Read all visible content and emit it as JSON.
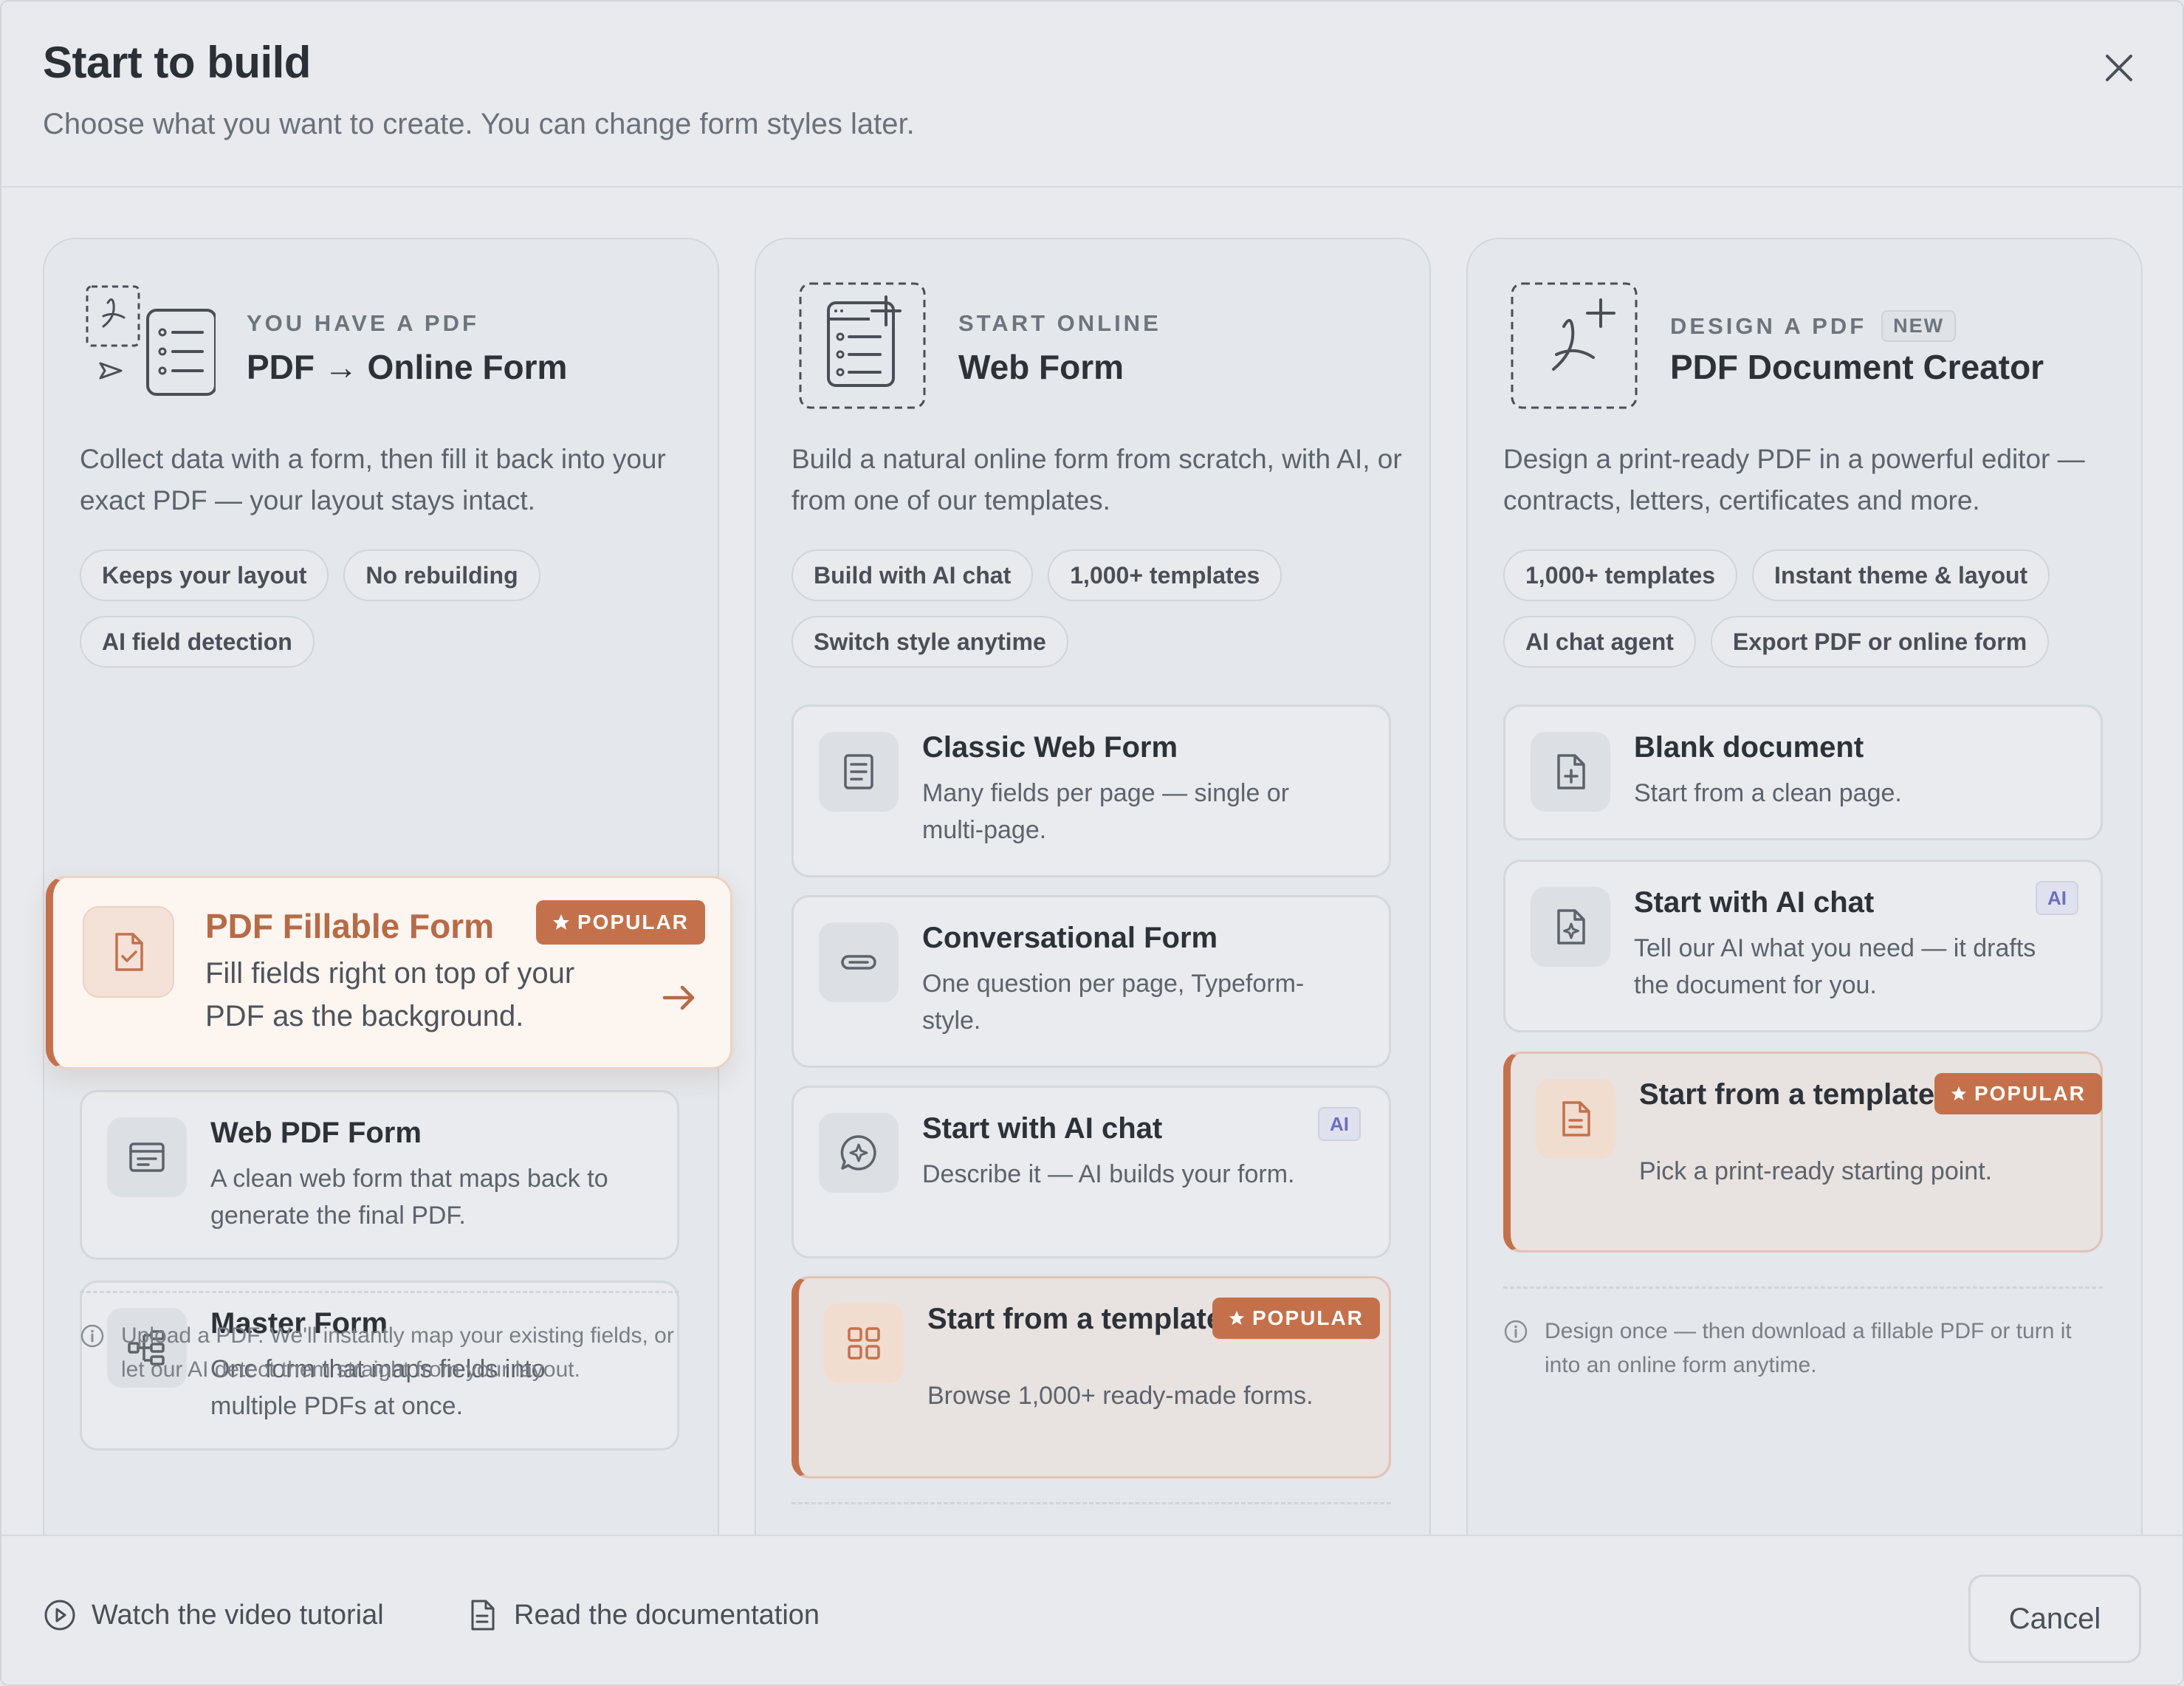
{
  "header": {
    "title": "Start to build",
    "subtitle": "Choose what you want to create. You can change form styles later."
  },
  "columns": [
    {
      "eyebrow": "YOU HAVE A PDF",
      "title": "PDF → Online Form",
      "description": "Collect data with a form, then fill it back into your exact PDF — your layout stays intact.",
      "chips": [
        "Keeps your layout",
        "No rebuilding",
        "AI field detection"
      ],
      "featured": {
        "title": "PDF Fillable Form",
        "badge": "POPULAR",
        "description": "Fill fields right on top of your PDF as the background."
      },
      "options": [
        {
          "title": "Web PDF Form",
          "description": "A clean web form that maps back to generate the final PDF."
        },
        {
          "title": "Master Form",
          "description": "One form that maps fields into multiple PDFs at once."
        }
      ],
      "note": "Upload a PDF. We'll instantly map your existing fields, or let our AI detect them straight from your layout."
    },
    {
      "eyebrow": "START ONLINE",
      "title": "Web Form",
      "description": "Build a natural online form from scratch, with AI, or from one of our templates.",
      "chips": [
        "Build with AI chat",
        "1,000+ templates",
        "Switch style anytime"
      ],
      "options": [
        {
          "title": "Classic Web Form",
          "description": "Many fields per page — single or multi-page."
        },
        {
          "title": "Conversational Form",
          "description": "One question per page, Typeform-style."
        },
        {
          "title": "Start with AI chat",
          "description": "Describe it — AI builds your form.",
          "badge": "AI"
        },
        {
          "title": "Start from a template",
          "description": "Browse 1,000+ ready-made forms.",
          "badge": "POPULAR"
        }
      ]
    },
    {
      "eyebrow": "DESIGN A PDF",
      "eyebrow_badge": "NEW",
      "title": "PDF Document Creator",
      "description": "Design a print-ready PDF in a powerful editor — contracts, letters, certificates and more.",
      "chips": [
        "1,000+ templates",
        "Instant theme & layout",
        "AI chat agent",
        "Export PDF or online form"
      ],
      "options": [
        {
          "title": "Blank document",
          "description": "Start from a clean page."
        },
        {
          "title": "Start with AI chat",
          "description": "Tell our AI what you need — it drafts the document for you.",
          "badge": "AI"
        },
        {
          "title": "Start from a template",
          "description": "Pick a print-ready starting point.",
          "badge": "POPULAR"
        }
      ],
      "note": "Design once — then download a fillable PDF or turn it into an online form anytime."
    }
  ],
  "footer": {
    "video_label": "Watch the video tutorial",
    "docs_label": "Read the documentation",
    "cancel_label": "Cancel"
  },
  "colors": {
    "accent": "#c4714b",
    "background": "#e8eaee",
    "text": "#2d3138",
    "muted": "#6b717a",
    "ai_badge": "#6b6fc4"
  },
  "icons": {
    "close": "close-icon",
    "pdf_convert": "pdf-to-form-icon",
    "web_form": "web-form-add-icon",
    "pdf_creator": "pdf-add-icon"
  }
}
